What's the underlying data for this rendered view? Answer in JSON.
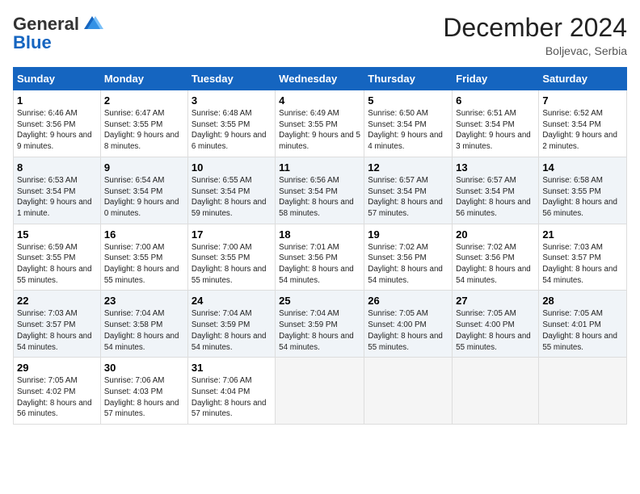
{
  "header": {
    "logo_general": "General",
    "logo_blue": "Blue",
    "month_title": "December 2024",
    "location": "Boljevac, Serbia"
  },
  "days_of_week": [
    "Sunday",
    "Monday",
    "Tuesday",
    "Wednesday",
    "Thursday",
    "Friday",
    "Saturday"
  ],
  "weeks": [
    [
      {
        "num": "1",
        "sunrise": "6:46 AM",
        "sunset": "3:56 PM",
        "daylight": "9 hours and 9 minutes."
      },
      {
        "num": "2",
        "sunrise": "6:47 AM",
        "sunset": "3:55 PM",
        "daylight": "9 hours and 8 minutes."
      },
      {
        "num": "3",
        "sunrise": "6:48 AM",
        "sunset": "3:55 PM",
        "daylight": "9 hours and 6 minutes."
      },
      {
        "num": "4",
        "sunrise": "6:49 AM",
        "sunset": "3:55 PM",
        "daylight": "9 hours and 5 minutes."
      },
      {
        "num": "5",
        "sunrise": "6:50 AM",
        "sunset": "3:54 PM",
        "daylight": "9 hours and 4 minutes."
      },
      {
        "num": "6",
        "sunrise": "6:51 AM",
        "sunset": "3:54 PM",
        "daylight": "9 hours and 3 minutes."
      },
      {
        "num": "7",
        "sunrise": "6:52 AM",
        "sunset": "3:54 PM",
        "daylight": "9 hours and 2 minutes."
      }
    ],
    [
      {
        "num": "8",
        "sunrise": "6:53 AM",
        "sunset": "3:54 PM",
        "daylight": "9 hours and 1 minute."
      },
      {
        "num": "9",
        "sunrise": "6:54 AM",
        "sunset": "3:54 PM",
        "daylight": "9 hours and 0 minutes."
      },
      {
        "num": "10",
        "sunrise": "6:55 AM",
        "sunset": "3:54 PM",
        "daylight": "8 hours and 59 minutes."
      },
      {
        "num": "11",
        "sunrise": "6:56 AM",
        "sunset": "3:54 PM",
        "daylight": "8 hours and 58 minutes."
      },
      {
        "num": "12",
        "sunrise": "6:57 AM",
        "sunset": "3:54 PM",
        "daylight": "8 hours and 57 minutes."
      },
      {
        "num": "13",
        "sunrise": "6:57 AM",
        "sunset": "3:54 PM",
        "daylight": "8 hours and 56 minutes."
      },
      {
        "num": "14",
        "sunrise": "6:58 AM",
        "sunset": "3:55 PM",
        "daylight": "8 hours and 56 minutes."
      }
    ],
    [
      {
        "num": "15",
        "sunrise": "6:59 AM",
        "sunset": "3:55 PM",
        "daylight": "8 hours and 55 minutes."
      },
      {
        "num": "16",
        "sunrise": "7:00 AM",
        "sunset": "3:55 PM",
        "daylight": "8 hours and 55 minutes."
      },
      {
        "num": "17",
        "sunrise": "7:00 AM",
        "sunset": "3:55 PM",
        "daylight": "8 hours and 55 minutes."
      },
      {
        "num": "18",
        "sunrise": "7:01 AM",
        "sunset": "3:56 PM",
        "daylight": "8 hours and 54 minutes."
      },
      {
        "num": "19",
        "sunrise": "7:02 AM",
        "sunset": "3:56 PM",
        "daylight": "8 hours and 54 minutes."
      },
      {
        "num": "20",
        "sunrise": "7:02 AM",
        "sunset": "3:56 PM",
        "daylight": "8 hours and 54 minutes."
      },
      {
        "num": "21",
        "sunrise": "7:03 AM",
        "sunset": "3:57 PM",
        "daylight": "8 hours and 54 minutes."
      }
    ],
    [
      {
        "num": "22",
        "sunrise": "7:03 AM",
        "sunset": "3:57 PM",
        "daylight": "8 hours and 54 minutes."
      },
      {
        "num": "23",
        "sunrise": "7:04 AM",
        "sunset": "3:58 PM",
        "daylight": "8 hours and 54 minutes."
      },
      {
        "num": "24",
        "sunrise": "7:04 AM",
        "sunset": "3:59 PM",
        "daylight": "8 hours and 54 minutes."
      },
      {
        "num": "25",
        "sunrise": "7:04 AM",
        "sunset": "3:59 PM",
        "daylight": "8 hours and 54 minutes."
      },
      {
        "num": "26",
        "sunrise": "7:05 AM",
        "sunset": "4:00 PM",
        "daylight": "8 hours and 55 minutes."
      },
      {
        "num": "27",
        "sunrise": "7:05 AM",
        "sunset": "4:00 PM",
        "daylight": "8 hours and 55 minutes."
      },
      {
        "num": "28",
        "sunrise": "7:05 AM",
        "sunset": "4:01 PM",
        "daylight": "8 hours and 55 minutes."
      }
    ],
    [
      {
        "num": "29",
        "sunrise": "7:05 AM",
        "sunset": "4:02 PM",
        "daylight": "8 hours and 56 minutes."
      },
      {
        "num": "30",
        "sunrise": "7:06 AM",
        "sunset": "4:03 PM",
        "daylight": "8 hours and 57 minutes."
      },
      {
        "num": "31",
        "sunrise": "7:06 AM",
        "sunset": "4:04 PM",
        "daylight": "8 hours and 57 minutes."
      },
      null,
      null,
      null,
      null
    ]
  ]
}
